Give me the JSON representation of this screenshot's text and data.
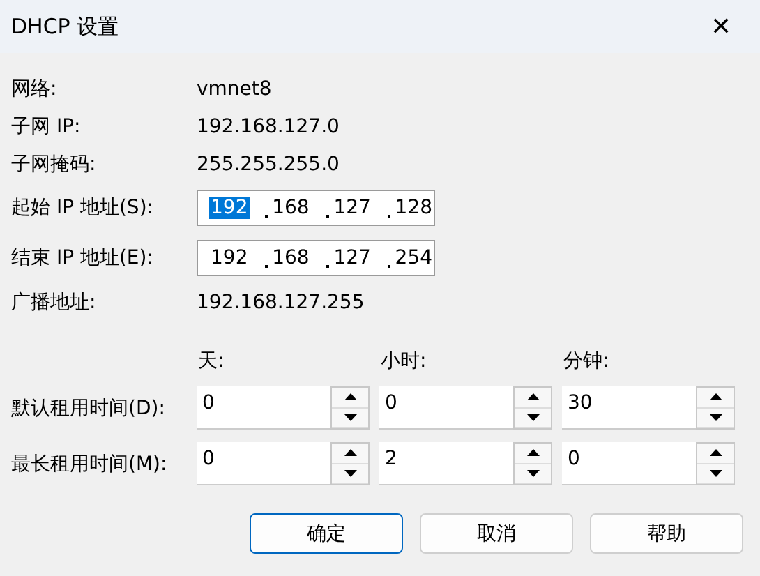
{
  "window": {
    "title": "DHCP 设置",
    "close": "✕"
  },
  "info": [
    {
      "label": "网络:",
      "value": "vmnet8"
    },
    {
      "label": "子网 IP:",
      "value": "192.168.127.0"
    },
    {
      "label": "子网掩码:",
      "value": "255.255.255.0"
    }
  ],
  "ip_fields": [
    {
      "label": "起始 IP 地址(S):",
      "octets": [
        {
          "text": "192",
          "selected": true
        },
        {
          "text": "168",
          "selected": false
        },
        {
          "text": "127",
          "selected": false
        },
        {
          "text": "128",
          "selected": false
        }
      ]
    },
    {
      "label": "结束 IP 地址(E):",
      "octets": [
        {
          "text": "192",
          "selected": false
        },
        {
          "text": "168",
          "selected": false
        },
        {
          "text": "127",
          "selected": false
        },
        {
          "text": "254",
          "selected": false
        }
      ]
    }
  ],
  "broadcast": {
    "label": "广播地址:",
    "value": "192.168.127.255"
  },
  "lease_columns": [
    "天:",
    "小时:",
    "分钟:"
  ],
  "lease_rows": [
    {
      "label": "默认租用时间(D):",
      "values": [
        "0",
        "0",
        "30"
      ]
    },
    {
      "label": "最长租用时间(M):",
      "values": [
        "0",
        "2",
        "0"
      ]
    }
  ],
  "buttons": [
    {
      "label": "确定",
      "default": true
    },
    {
      "label": "取消",
      "default": false
    },
    {
      "label": "帮助",
      "default": false
    }
  ]
}
